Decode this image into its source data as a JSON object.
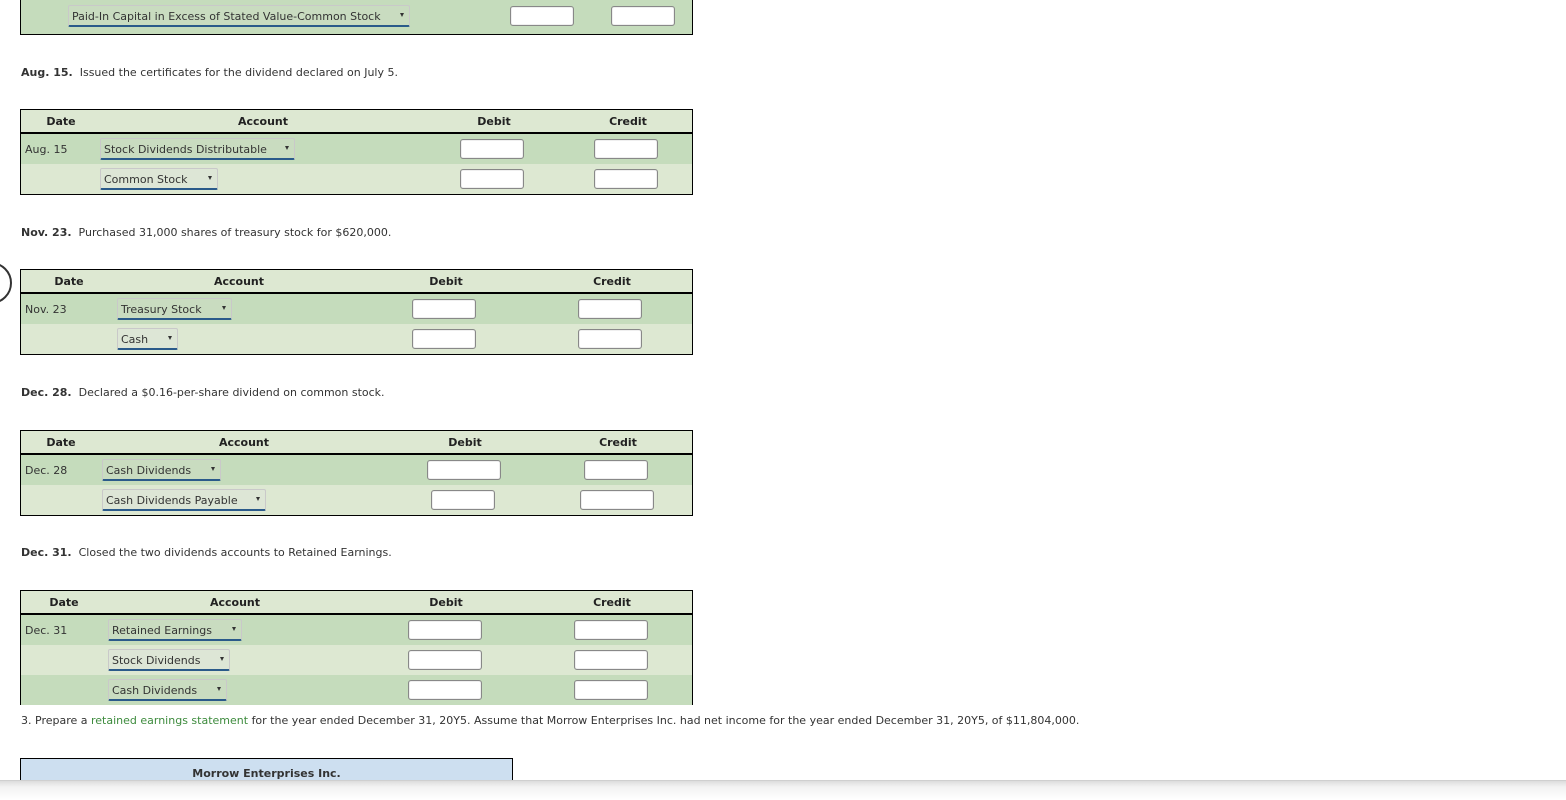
{
  "top_fragment": {
    "account": "Paid-In Capital in Excess of Stated Value-Common Stock"
  },
  "columns": {
    "date": "Date",
    "account": "Account",
    "debit": "Debit",
    "credit": "Credit"
  },
  "entries": [
    {
      "date_label": "Aug. 15.",
      "description": "Issued the certificates for the dividend declared on July 5.",
      "rows": [
        {
          "date": "Aug. 15",
          "account": "Stock Dividends Distributable",
          "debit": "",
          "credit": ""
        },
        {
          "date": "",
          "account": "Common Stock",
          "debit": "",
          "credit": ""
        }
      ]
    },
    {
      "date_label": "Nov. 23.",
      "description": "Purchased 31,000 shares of treasury stock for $620,000.",
      "rows": [
        {
          "date": "Nov. 23",
          "account": "Treasury Stock",
          "debit": "",
          "credit": ""
        },
        {
          "date": "",
          "account": "Cash",
          "debit": "",
          "credit": ""
        }
      ]
    },
    {
      "date_label": "Dec. 28.",
      "description": "Declared a $0.16-per-share dividend on common stock.",
      "rows": [
        {
          "date": "Dec. 28",
          "account": "Cash Dividends",
          "debit": "",
          "credit": ""
        },
        {
          "date": "",
          "account": "Cash Dividends Payable",
          "debit": "",
          "credit": ""
        }
      ]
    },
    {
      "date_label": "Dec. 31.",
      "description": "Closed the two dividends accounts to Retained Earnings.",
      "rows": [
        {
          "date": "Dec. 31",
          "account": "Retained Earnings",
          "debit": "",
          "credit": ""
        },
        {
          "date": "",
          "account": "Stock Dividends",
          "debit": "",
          "credit": ""
        },
        {
          "date": "",
          "account": "Cash Dividends",
          "debit": "",
          "credit": ""
        }
      ]
    }
  ],
  "part3": {
    "number": "3.",
    "prefix": "Prepare a",
    "link": "retained earnings statement",
    "suffix": "for the year ended December 31, 20Y5. Assume that Morrow Enterprises Inc. had net income for the year ended December 31, 20Y5, of $11,804,000."
  },
  "statement": {
    "company": "Morrow Enterprises Inc."
  },
  "colors": {
    "header_bg": "#dde8d2",
    "row_dark": "#c5dcbc",
    "link": "#3d8b3d",
    "statement_bg": "#cddff0"
  }
}
